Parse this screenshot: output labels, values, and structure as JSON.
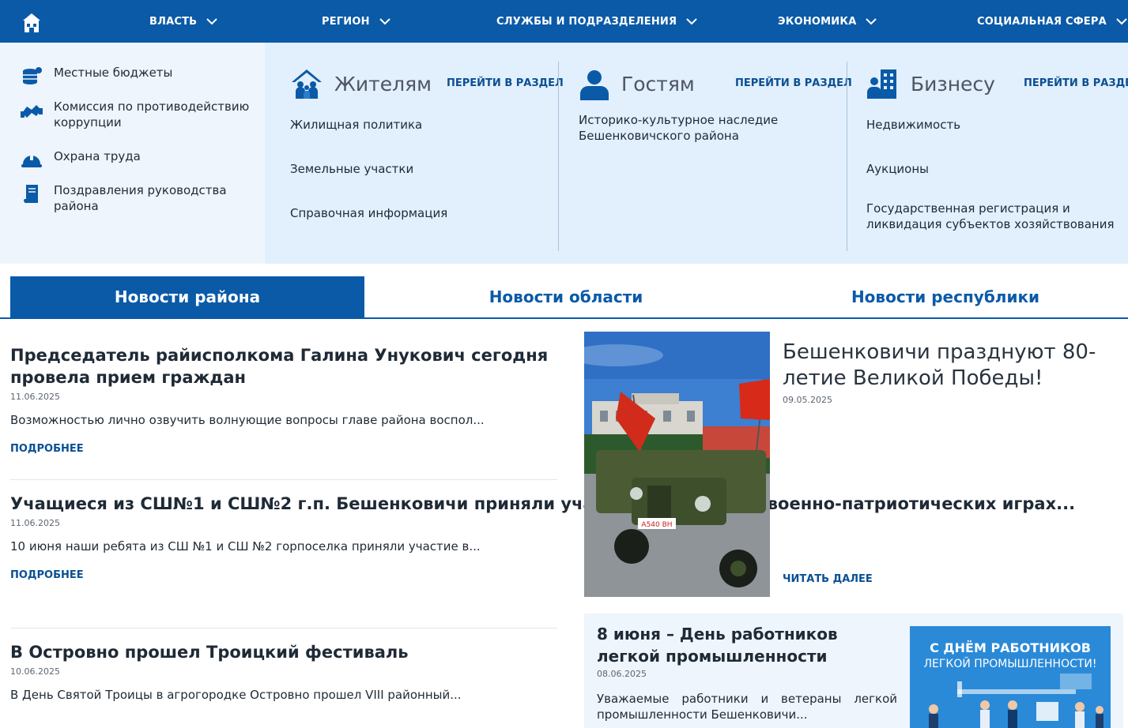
{
  "nav": {
    "home_icon": "home-icon",
    "items": [
      "ВЛАСТЬ",
      "РЕГИОН",
      "СЛУЖБЫ И ПОДРАЗДЕЛЕНИЯ",
      "ЭКОНОМИКА",
      "СОЦИАЛЬНАЯ СФЕРА"
    ]
  },
  "mega_left": [
    {
      "label": "Местные бюджеты",
      "icon": "coins-icon"
    },
    {
      "label": "Комиссия по противодействию коррупции",
      "icon": "handshake-icon"
    },
    {
      "label": "Охрана труда",
      "icon": "helmet-icon"
    },
    {
      "label": "Поздравления руководства района",
      "icon": "scroll-icon"
    }
  ],
  "columns": [
    {
      "title": "Жителям",
      "link": "ПЕРЕЙТИ В РАЗДЕЛ",
      "icon": "residents-icon",
      "items": [
        "Жилищная политика",
        "Земельные участки",
        "Справочная информация"
      ]
    },
    {
      "title": "Гостям",
      "link": "ПЕРЕЙТИ В РАЗДЕЛ",
      "icon": "guest-icon",
      "items": [
        "Историко-культурное наследие Бешенковичского района"
      ]
    },
    {
      "title": "Бизнесу",
      "link": "ПЕРЕЙТИ В РАЗДЕЛ",
      "icon": "business-icon",
      "items": [
        "Недвижимость",
        "Аукционы",
        "Государственная регистрация и ликвидация субъектов хозяйствования"
      ]
    }
  ],
  "tabs": [
    "Новости района",
    "Новости области",
    "Новости республики"
  ],
  "news": [
    {
      "title": "Председатель райисполкома Галина Унукович сегодня провела прием граждан",
      "date": "11.06.2025",
      "text": "Возможностью лично озвучить волнующие вопросы главе района воспол...",
      "more": "ПОДРОБНЕЕ"
    },
    {
      "title": "Учащиеся из СШ№1 и СШ№2 г.п. Бешенковичи приняли участие в областных военно-патриотических играх...",
      "date": "11.06.2025",
      "text": "10 июня наши ребята из СШ №1 и СШ №2 горпоселка приняли участие в...",
      "more": "ПОДРОБНЕЕ"
    },
    {
      "title": "В Островно прошел Троицкий фестиваль",
      "date": "10.06.2025",
      "text": "В День Святой Троицы в агрогородке Островно прошел VIII районный...",
      "more": ""
    }
  ],
  "featured": {
    "title": "Бешенковичи празднуют 80-летие Великой Победы!",
    "date": "09.05.2025",
    "more": "ЧИТАТЬ ДАЛЕЕ",
    "plate": "А540 ВН"
  },
  "card": {
    "title": "8 июня – День работников легкой промышленности",
    "date": "08.06.2025",
    "text": "Уважаемые работники и ветераны легкой промышленности Бешенковичи...",
    "img_line1": "С ДНЁМ РАБОТНИКОВ",
    "img_line2": "ЛЕГКОЙ ПРОМЫШЛЕННОСТИ!"
  },
  "colors": {
    "brand": "#0a5aa8",
    "menu_bg": "#e2effc",
    "link": "#0a4f93"
  }
}
